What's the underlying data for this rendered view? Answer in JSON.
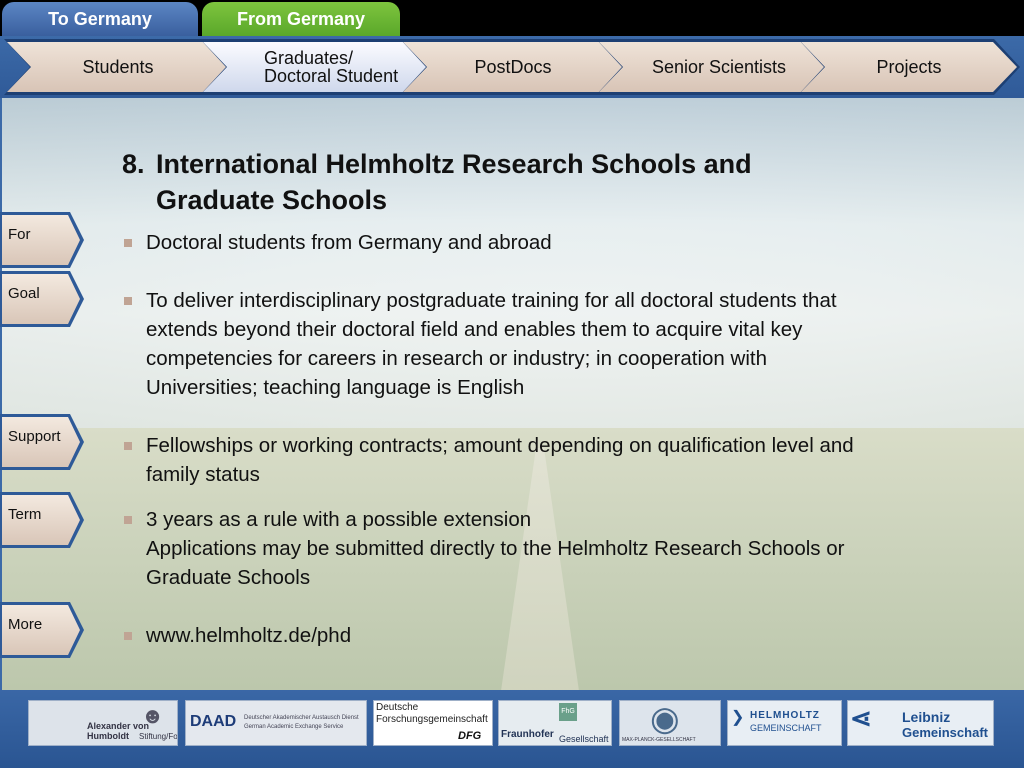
{
  "top_tabs": {
    "to_germany": "To Germany",
    "from_germany": "From Germany"
  },
  "nav": {
    "items": [
      {
        "label": "Students",
        "active": false
      },
      {
        "label": "Graduates/\nDoctoral Student",
        "active": true
      },
      {
        "label": "PostDocs",
        "active": false
      },
      {
        "label": "Senior Scientists",
        "active": false
      },
      {
        "label": "Projects",
        "active": false
      }
    ]
  },
  "side_tabs": {
    "for": "For",
    "goal": "Goal",
    "support": "Support",
    "term": "Term",
    "more": "More"
  },
  "content": {
    "title_number": "8.",
    "title_line1": "International Helmholtz Research Schools and",
    "title_line2": "Graduate Schools",
    "for_text": "Doctoral students from Germany and abroad",
    "goal_text": "To deliver interdisciplinary postgraduate training for all doctoral students that\nextends beyond their doctoral field and enables them to acquire vital key\ncompetencies for careers in research or industry; in cooperation with\nUniversities; teaching language is English",
    "support_text": "Fellowships or working contracts; amount depending on qualification level and\nfamily status",
    "term_text": "3 years as a rule with a possible extension\nApplications may be submitted directly to the Helmholtz Research Schools or\nGraduate Schools",
    "more_text": "www.helmholtz.de/phd"
  },
  "footer": {
    "humboldt_line1": "Alexander von Humboldt",
    "humboldt_line2": "Stiftung/Foundation",
    "daad": "DAAD",
    "daad_sub1": "Deutscher Akademischer Austausch Dienst",
    "daad_sub2": "German Academic Exchange Service",
    "dfg_line1": "Deutsche",
    "dfg_line2": "Forschungsgemeinschaft",
    "dfg_abbr": "DFG",
    "fraunhofer": "Fraunhofer",
    "fraunhofer_sub": "Gesellschaft",
    "fhg": "FhG",
    "maxplanck": "MAX-PLANCK-GESELLSCHAFT",
    "helmholtz_line1": "HELMHOLTZ",
    "helmholtz_line2": "GEMEINSCHAFT",
    "leibniz_line1": "Leibniz",
    "leibniz_line2": "Gemeinschaft"
  },
  "colors": {
    "nav_blue": "#2f5a98",
    "tab_green": "#5aa82a",
    "tab_blue": "#3a5f9e",
    "bullet": "#c0a494"
  }
}
